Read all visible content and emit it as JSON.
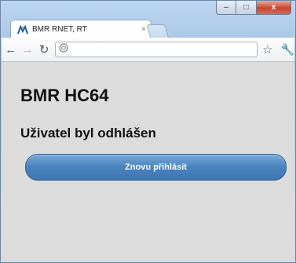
{
  "browser": {
    "tab_title": "BMR RNET, RT",
    "tab_close": "×",
    "url": "",
    "window_buttons": {
      "minimize": "–",
      "maximize": "□",
      "close": "x"
    },
    "toolbar_icons": [
      "back-icon",
      "forward-icon",
      "reload-icon",
      "page-icon",
      "bookmark-star-icon",
      "wrench-icon"
    ]
  },
  "page": {
    "title": "BMR HC64",
    "message": "Uživatel byl odhlášen",
    "relogin_button": "Znovu přihlásit"
  },
  "colors": {
    "button_top": "#78a9d8",
    "button_bottom": "#3f76b2",
    "page_bg": "#dcdcdc"
  }
}
